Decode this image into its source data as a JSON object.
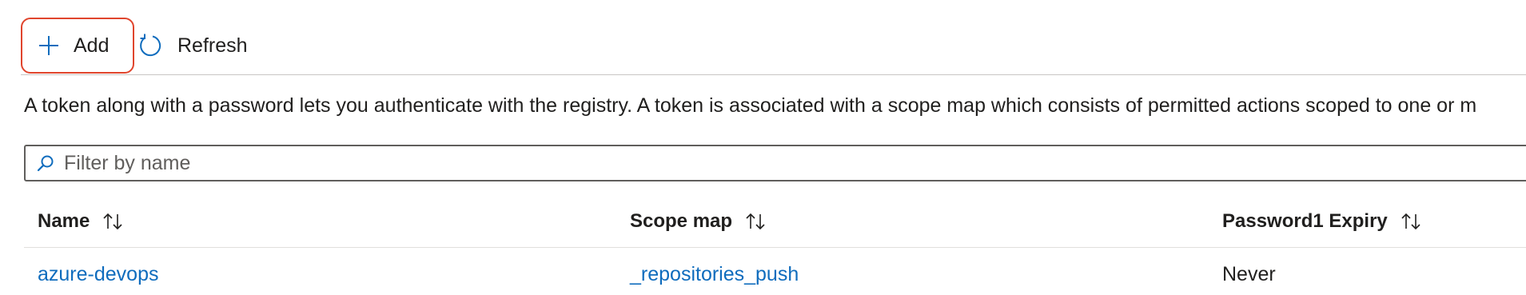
{
  "toolbar": {
    "add_label": "Add",
    "refresh_label": "Refresh"
  },
  "description": "A token along with a password lets you authenticate with the registry. A token is associated with a scope map which consists of permitted actions scoped to one or m",
  "filter": {
    "placeholder": "Filter by name",
    "value": ""
  },
  "table": {
    "columns": [
      "Name",
      "Scope map",
      "Password1 Expiry"
    ],
    "rows": [
      {
        "name": "azure-devops",
        "scope_map": "_repositories_push",
        "password1_expiry": "Never"
      }
    ]
  },
  "colors": {
    "link": "#0f6cbd",
    "add_focus_border": "#e0452d",
    "icon_blue": "#0f6cbd"
  },
  "icons": {
    "add": "plus-icon",
    "refresh": "refresh-icon",
    "filter": "search-icon",
    "sort": "sort-arrows-icon"
  }
}
